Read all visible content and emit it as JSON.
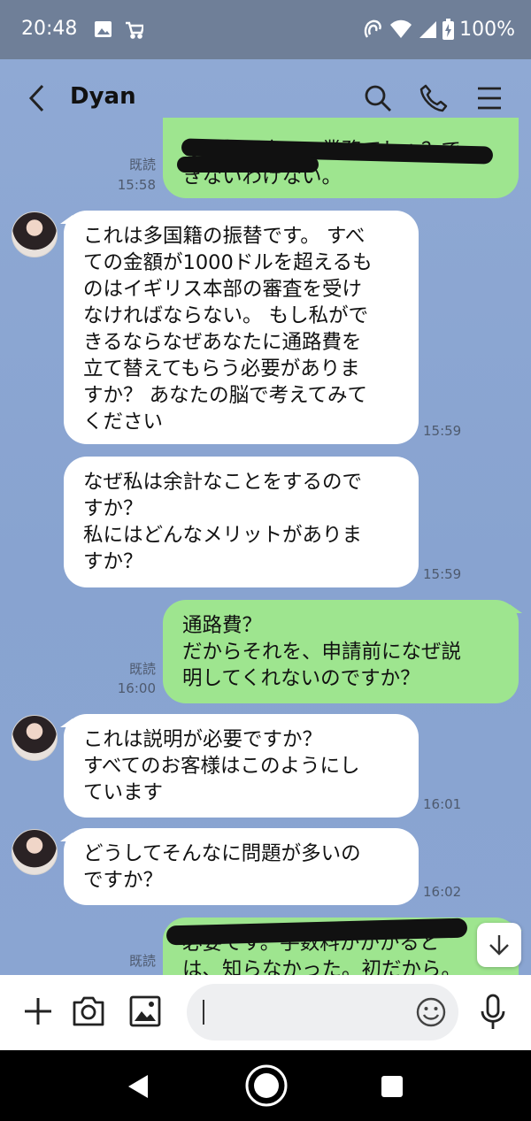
{
  "status_bar": {
    "time": "20:48",
    "battery": "100%"
  },
  "header": {
    "contact_name": "Dyan"
  },
  "messages": [
    {
      "dir": "out",
      "text": "の銀行同士での業務でしょ？で\nきないわけない。",
      "read": "既読",
      "time": "15:58",
      "redacted": true
    },
    {
      "dir": "in",
      "text": "これは多国籍の振替です。 すべ\nての金額が1000ドルを超えるも\nのはイギリス本部の審査を受け\nなければならない。 もし私がで\nきるならなぜあなたに通路費を\n立て替えてもらう必要がありま\nすか？ あなたの脳で考えてみて\nください",
      "time": "15:59"
    },
    {
      "dir": "in",
      "text": "なぜ私は余計なことをするので\nすか？\n私にはどんなメリットがありま\nすか？",
      "time": "15:59"
    },
    {
      "dir": "out",
      "text": "通路費？\nだからそれを、申請前になぜ説\n明してくれないのですか？",
      "read": "既読",
      "time": "16:00"
    },
    {
      "dir": "in",
      "text": "これは説明が必要ですか？\nすべてのお客様はこのようにし\nています",
      "time": "16:01"
    },
    {
      "dir": "in",
      "text": "どうしてそんなに問題が多いの\nですか？",
      "time": "16:02"
    },
    {
      "dir": "out",
      "text": "必要です。手数料かかかると\nは、知らなかった。初だから。",
      "read": "既読",
      "redacted": true
    }
  ],
  "input": {
    "placeholder": ""
  }
}
